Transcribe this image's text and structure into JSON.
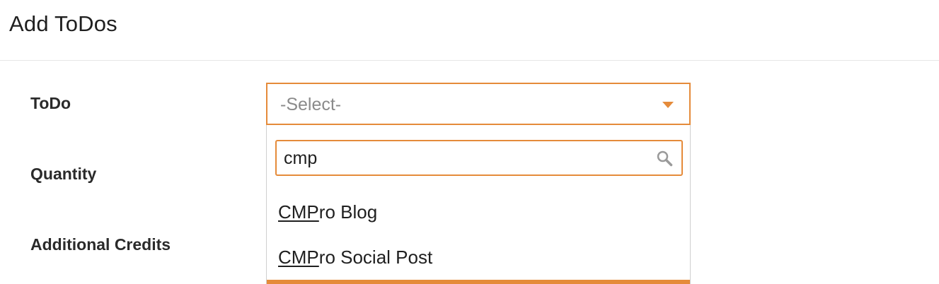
{
  "page": {
    "title": "Add ToDos"
  },
  "form": {
    "todo_label": "ToDo",
    "quantity_label": "Quantity",
    "credits_label": "Additional Credits",
    "todo_select": {
      "placeholder": "-Select-"
    }
  },
  "dropdown": {
    "search_value": "cmp",
    "options": [
      {
        "match": "CMP",
        "rest": "ro Blog"
      },
      {
        "match": "CMP",
        "rest": "ro Social Post"
      }
    ]
  },
  "colors": {
    "accent": "#e58b3a"
  },
  "icons": {
    "caret": "caret-down-icon",
    "search": "search-icon"
  }
}
